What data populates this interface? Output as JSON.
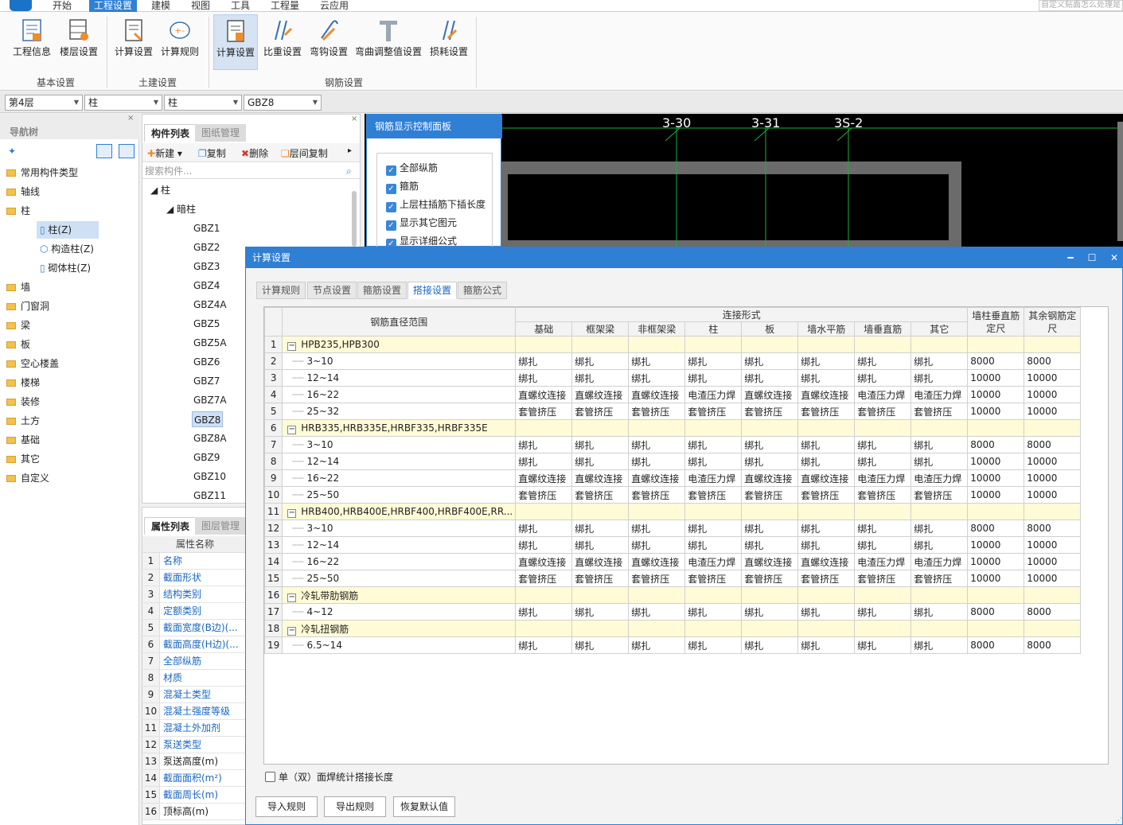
{
  "menu": {
    "items": [
      "开始",
      "工程设置",
      "建模",
      "视图",
      "工具",
      "工程量",
      "云应用"
    ],
    "active_index": 1,
    "search_placeholder": "自定义贴面怎么处理是"
  },
  "ribbon": {
    "buttons": [
      "工程信息",
      "楼层设置",
      "计算设置",
      "计算规则",
      "计算设置",
      "比重设置",
      "弯钩设置",
      "弯曲调整值设置",
      "损耗设置"
    ],
    "groups": [
      "基本设置",
      "土建设置",
      "钢筋设置"
    ]
  },
  "selectors": [
    "第4层",
    "柱",
    "柱",
    "GBZ8"
  ],
  "nav": {
    "title": "导航树",
    "items": [
      "常用构件类型",
      "轴线",
      "柱",
      "柱(Z)",
      "构造柱(Z)",
      "砌体柱(Z)",
      "墙",
      "门窗洞",
      "梁",
      "板",
      "空心楼盖",
      "楼梯",
      "装修",
      "土方",
      "基础",
      "其它",
      "自定义"
    ]
  },
  "component_panel": {
    "tabs": [
      "构件列表",
      "图纸管理"
    ],
    "toolbar": {
      "new": "新建",
      "copy": "复制",
      "delete": "删除",
      "floor_copy": "层间复制"
    },
    "search_placeholder": "搜索构件...",
    "tree_root": "柱",
    "tree_sub": "暗柱",
    "items": [
      "GBZ1",
      "GBZ2",
      "GBZ3",
      "GBZ4",
      "GBZ4A",
      "GBZ5",
      "GBZ5A",
      "GBZ6",
      "GBZ7",
      "GBZ7A",
      "GBZ8",
      "GBZ8A",
      "GBZ9",
      "GBZ10",
      "GBZ11"
    ],
    "selected": "GBZ8"
  },
  "property_panel": {
    "tabs": [
      "属性列表",
      "图层管理"
    ],
    "header": "属性名称",
    "rows": [
      {
        "n": "1",
        "name": "名称"
      },
      {
        "n": "2",
        "name": "截面形状"
      },
      {
        "n": "3",
        "name": "结构类别"
      },
      {
        "n": "4",
        "name": "定额类别"
      },
      {
        "n": "5",
        "name": "截面宽度(B边)(..."
      },
      {
        "n": "6",
        "name": "截面高度(H边)(..."
      },
      {
        "n": "7",
        "name": "全部纵筋"
      },
      {
        "n": "8",
        "name": "材质"
      },
      {
        "n": "9",
        "name": "混凝土类型"
      },
      {
        "n": "10",
        "name": "混凝土强度等级"
      },
      {
        "n": "11",
        "name": "混凝土外加剂"
      },
      {
        "n": "12",
        "name": "泵送类型"
      },
      {
        "n": "13",
        "name": "泵送高度(m)"
      },
      {
        "n": "14",
        "name": "截面面积(m²)"
      },
      {
        "n": "15",
        "name": "截面周长(m)"
      },
      {
        "n": "16",
        "name": "顶标高(m)"
      }
    ]
  },
  "canvas": {
    "labels": [
      "3-30",
      "3-31",
      "3S-2"
    ]
  },
  "control_panel": {
    "title": "钢筋显示控制面板",
    "checks": [
      "全部纵筋",
      "箍筋",
      "上层柱插筋下插长度",
      "显示其它图元",
      "显示详细公式"
    ]
  },
  "dialog": {
    "title": "计算设置",
    "tabs": [
      "计算规则",
      "节点设置",
      "箍筋设置",
      "搭接设置",
      "箍筋公式"
    ],
    "active_tab": 3,
    "headers": {
      "range": "钢筋直径范围",
      "conn": "连接形式",
      "cols": [
        "基础",
        "框架梁",
        "非框架梁",
        "柱",
        "板",
        "墙水平筋",
        "墙垂直筋",
        "其它"
      ],
      "wall_len": "墙柱垂直筋定尺",
      "other_len": "其余钢筋定尺"
    },
    "rows": [
      {
        "n": "1",
        "group": true,
        "label": "HPB235,HPB300"
      },
      {
        "n": "2",
        "label": "3~10",
        "vals": [
          "绑扎",
          "绑扎",
          "绑扎",
          "绑扎",
          "绑扎",
          "绑扎",
          "绑扎",
          "绑扎",
          "8000",
          "8000"
        ]
      },
      {
        "n": "3",
        "label": "12~14",
        "vals": [
          "绑扎",
          "绑扎",
          "绑扎",
          "绑扎",
          "绑扎",
          "绑扎",
          "绑扎",
          "绑扎",
          "10000",
          "10000"
        ]
      },
      {
        "n": "4",
        "label": "16~22",
        "vals": [
          "直螺纹连接",
          "直螺纹连接",
          "直螺纹连接",
          "电渣压力焊",
          "直螺纹连接",
          "直螺纹连接",
          "电渣压力焊",
          "电渣压力焊",
          "10000",
          "10000"
        ]
      },
      {
        "n": "5",
        "label": "25~32",
        "vals": [
          "套管挤压",
          "套管挤压",
          "套管挤压",
          "套管挤压",
          "套管挤压",
          "套管挤压",
          "套管挤压",
          "套管挤压",
          "10000",
          "10000"
        ]
      },
      {
        "n": "6",
        "group": true,
        "label": "HRB335,HRB335E,HRBF335,HRBF335E"
      },
      {
        "n": "7",
        "label": "3~10",
        "vals": [
          "绑扎",
          "绑扎",
          "绑扎",
          "绑扎",
          "绑扎",
          "绑扎",
          "绑扎",
          "绑扎",
          "8000",
          "8000"
        ]
      },
      {
        "n": "8",
        "label": "12~14",
        "vals": [
          "绑扎",
          "绑扎",
          "绑扎",
          "绑扎",
          "绑扎",
          "绑扎",
          "绑扎",
          "绑扎",
          "10000",
          "10000"
        ]
      },
      {
        "n": "9",
        "label": "16~22",
        "vals": [
          "直螺纹连接",
          "直螺纹连接",
          "直螺纹连接",
          "电渣压力焊",
          "直螺纹连接",
          "直螺纹连接",
          "电渣压力焊",
          "电渣压力焊",
          "10000",
          "10000"
        ]
      },
      {
        "n": "10",
        "label": "25~50",
        "vals": [
          "套管挤压",
          "套管挤压",
          "套管挤压",
          "套管挤压",
          "套管挤压",
          "套管挤压",
          "套管挤压",
          "套管挤压",
          "10000",
          "10000"
        ]
      },
      {
        "n": "11",
        "group": true,
        "label": "HRB400,HRB400E,HRBF400,HRBF400E,RR..."
      },
      {
        "n": "12",
        "label": "3~10",
        "vals": [
          "绑扎",
          "绑扎",
          "绑扎",
          "绑扎",
          "绑扎",
          "绑扎",
          "绑扎",
          "绑扎",
          "8000",
          "8000"
        ]
      },
      {
        "n": "13",
        "label": "12~14",
        "vals": [
          "绑扎",
          "绑扎",
          "绑扎",
          "绑扎",
          "绑扎",
          "绑扎",
          "绑扎",
          "绑扎",
          "10000",
          "10000"
        ]
      },
      {
        "n": "14",
        "label": "16~22",
        "vals": [
          "直螺纹连接",
          "直螺纹连接",
          "直螺纹连接",
          "电渣压力焊",
          "直螺纹连接",
          "直螺纹连接",
          "电渣压力焊",
          "电渣压力焊",
          "10000",
          "10000"
        ]
      },
      {
        "n": "15",
        "label": "25~50",
        "vals": [
          "套管挤压",
          "套管挤压",
          "套管挤压",
          "套管挤压",
          "套管挤压",
          "套管挤压",
          "套管挤压",
          "套管挤压",
          "10000",
          "10000"
        ]
      },
      {
        "n": "16",
        "group": true,
        "label": "冷轧带肋钢筋"
      },
      {
        "n": "17",
        "label": "4~12",
        "vals": [
          "绑扎",
          "绑扎",
          "绑扎",
          "绑扎",
          "绑扎",
          "绑扎",
          "绑扎",
          "绑扎",
          "8000",
          "8000"
        ]
      },
      {
        "n": "18",
        "group": true,
        "label": "冷轧扭钢筋"
      },
      {
        "n": "19",
        "label": "6.5~14",
        "vals": [
          "绑扎",
          "绑扎",
          "绑扎",
          "绑扎",
          "绑扎",
          "绑扎",
          "绑扎",
          "绑扎",
          "8000",
          "8000"
        ]
      }
    ],
    "footer_check": "单（双）面焊统计搭接长度",
    "buttons": [
      "导入规则",
      "导出规则",
      "恢复默认值"
    ]
  }
}
